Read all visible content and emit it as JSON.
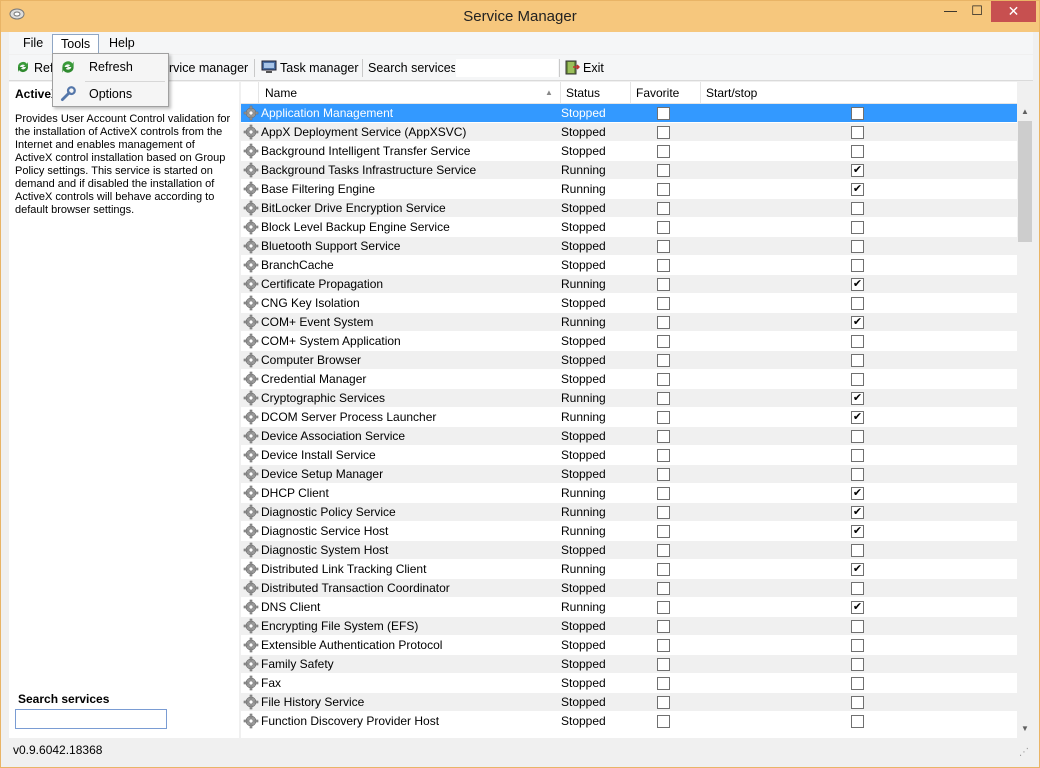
{
  "window": {
    "title": "Service Manager",
    "min_glyph": "—",
    "max_glyph": "☐",
    "close_glyph": "✕"
  },
  "menu": {
    "file": "File",
    "tools": "Tools",
    "help": "Help"
  },
  "dropdown": {
    "refresh": "Refresh",
    "options": "Options"
  },
  "toolbar": {
    "refresh_partial": "Refr",
    "service_manager_partial": "rvice manager",
    "task_manager": "Task manager",
    "search_label": "Search services:",
    "search_value": "",
    "exit": "Exit"
  },
  "left_panel": {
    "title": "ActiveX",
    "description": "Provides User Account Control validation for the installation of ActiveX controls from the Internet and enables management of ActiveX control installation based on Group Policy settings. This service is started on demand and if disabled the installation of ActiveX controls will behave according to default browser settings.",
    "search_label": "Search services",
    "search_value": ""
  },
  "grid": {
    "columns": {
      "name": "Name",
      "status": "Status",
      "favorite": "Favorite",
      "startstop": "Start/stop"
    },
    "sort_glyph": "▲",
    "rows": [
      {
        "name": "Application Management",
        "status": "Stopped",
        "favorite": false,
        "startstop": false,
        "selected": true
      },
      {
        "name": "AppX Deployment Service (AppXSVC)",
        "status": "Stopped",
        "favorite": false,
        "startstop": false
      },
      {
        "name": "Background Intelligent Transfer Service",
        "status": "Stopped",
        "favorite": false,
        "startstop": false
      },
      {
        "name": "Background Tasks Infrastructure Service",
        "status": "Running",
        "favorite": false,
        "startstop": true
      },
      {
        "name": "Base Filtering Engine",
        "status": "Running",
        "favorite": false,
        "startstop": true
      },
      {
        "name": "BitLocker Drive Encryption Service",
        "status": "Stopped",
        "favorite": false,
        "startstop": false
      },
      {
        "name": "Block Level Backup Engine Service",
        "status": "Stopped",
        "favorite": false,
        "startstop": false
      },
      {
        "name": "Bluetooth Support Service",
        "status": "Stopped",
        "favorite": false,
        "startstop": false
      },
      {
        "name": "BranchCache",
        "status": "Stopped",
        "favorite": false,
        "startstop": false
      },
      {
        "name": "Certificate Propagation",
        "status": "Running",
        "favorite": false,
        "startstop": true
      },
      {
        "name": "CNG Key Isolation",
        "status": "Stopped",
        "favorite": false,
        "startstop": false
      },
      {
        "name": "COM+ Event System",
        "status": "Running",
        "favorite": false,
        "startstop": true
      },
      {
        "name": "COM+ System Application",
        "status": "Stopped",
        "favorite": false,
        "startstop": false
      },
      {
        "name": "Computer Browser",
        "status": "Stopped",
        "favorite": false,
        "startstop": false
      },
      {
        "name": "Credential Manager",
        "status": "Stopped",
        "favorite": false,
        "startstop": false
      },
      {
        "name": "Cryptographic Services",
        "status": "Running",
        "favorite": false,
        "startstop": true
      },
      {
        "name": "DCOM Server Process Launcher",
        "status": "Running",
        "favorite": false,
        "startstop": true
      },
      {
        "name": "Device Association Service",
        "status": "Stopped",
        "favorite": false,
        "startstop": false
      },
      {
        "name": "Device Install Service",
        "status": "Stopped",
        "favorite": false,
        "startstop": false
      },
      {
        "name": "Device Setup Manager",
        "status": "Stopped",
        "favorite": false,
        "startstop": false
      },
      {
        "name": "DHCP Client",
        "status": "Running",
        "favorite": false,
        "startstop": true
      },
      {
        "name": "Diagnostic Policy Service",
        "status": "Running",
        "favorite": false,
        "startstop": true
      },
      {
        "name": "Diagnostic Service Host",
        "status": "Running",
        "favorite": false,
        "startstop": true
      },
      {
        "name": "Diagnostic System Host",
        "status": "Stopped",
        "favorite": false,
        "startstop": false
      },
      {
        "name": "Distributed Link Tracking Client",
        "status": "Running",
        "favorite": false,
        "startstop": true
      },
      {
        "name": "Distributed Transaction Coordinator",
        "status": "Stopped",
        "favorite": false,
        "startstop": false
      },
      {
        "name": "DNS Client",
        "status": "Running",
        "favorite": false,
        "startstop": true
      },
      {
        "name": "Encrypting File System (EFS)",
        "status": "Stopped",
        "favorite": false,
        "startstop": false
      },
      {
        "name": "Extensible Authentication Protocol",
        "status": "Stopped",
        "favorite": false,
        "startstop": false
      },
      {
        "name": "Family Safety",
        "status": "Stopped",
        "favorite": false,
        "startstop": false
      },
      {
        "name": "Fax",
        "status": "Stopped",
        "favorite": false,
        "startstop": false
      },
      {
        "name": "File History Service",
        "status": "Stopped",
        "favorite": false,
        "startstop": false
      },
      {
        "name": "Function Discovery Provider Host",
        "status": "Stopped",
        "favorite": false,
        "startstop": false
      }
    ]
  },
  "scrollbar": {
    "up_glyph": "▲",
    "down_glyph": "▼"
  },
  "statusbar": {
    "version": "v0.9.6042.18368",
    "grip_glyph": "⋰"
  },
  "colors": {
    "titlebar": "#f6c77d",
    "selection": "#3399ff",
    "accent_border": "#7a9cd3"
  }
}
